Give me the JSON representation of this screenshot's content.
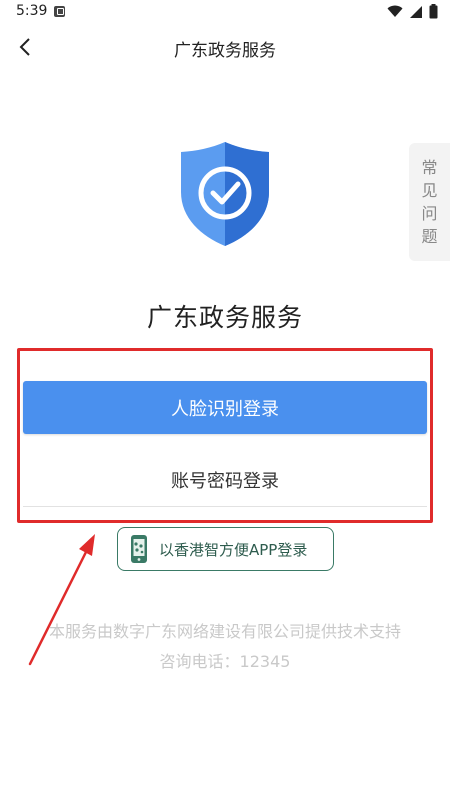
{
  "status_bar": {
    "time": "5:39",
    "icons": [
      "notification-icon",
      "wifi-icon",
      "signal-icon",
      "battery-icon"
    ]
  },
  "header": {
    "title": "广东政务服务",
    "back_icon": "chevron-left-icon"
  },
  "faq_tab": {
    "chars": [
      "常",
      "见",
      "问",
      "题"
    ]
  },
  "hero": {
    "icon": "shield-check-icon",
    "title": "广东政务服务"
  },
  "login": {
    "face_label": "人脸识别登录",
    "password_label": "账号密码登录",
    "hk_app_label": "以香港智方便APP登录",
    "hk_app_icon": "hk-app-phone-icon"
  },
  "footer": {
    "support_text": "本服务由数字广东网络建设有限公司提供技术支持",
    "hotline_text": "咨询电话：12345"
  },
  "colors": {
    "primary": "#4a90ee",
    "shield_light": "#5b9cf0",
    "shield_dark": "#2f6fd2",
    "annotation_red": "#e02b2b",
    "hk_green": "#3a7a66",
    "footer_text": "#c9c9c9"
  }
}
